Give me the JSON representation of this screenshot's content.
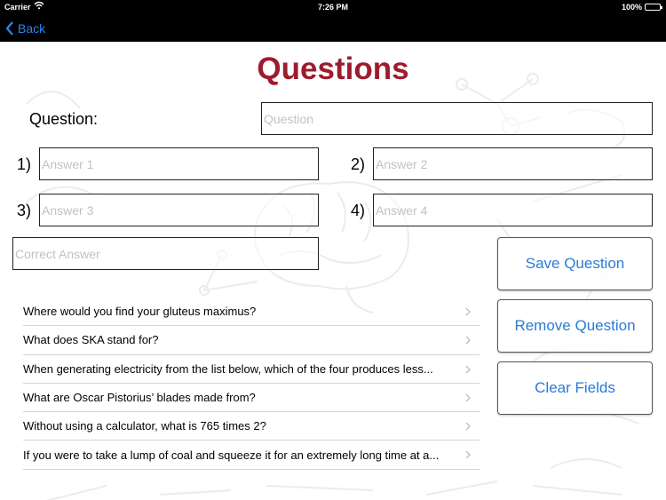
{
  "status_bar": {
    "carrier": "Carrier",
    "time": "7:26 PM",
    "battery": "100%"
  },
  "nav": {
    "back_label": "Back"
  },
  "title": "Questions",
  "question": {
    "label": "Question:",
    "placeholder": "Question"
  },
  "answers": [
    {
      "number": "1)",
      "placeholder": "Answer 1"
    },
    {
      "number": "2)",
      "placeholder": "Answer 2"
    },
    {
      "number": "3)",
      "placeholder": "Answer 3"
    },
    {
      "number": "4)",
      "placeholder": "Answer 4"
    }
  ],
  "correct_answer": {
    "placeholder": "Correct Answer"
  },
  "buttons": {
    "save": "Save Question",
    "remove": "Remove Question",
    "clear": "Clear Fields"
  },
  "questions": [
    "Where would you find your gluteus maximus?",
    "What does SKA stand for?",
    "When generating electricity from the list below, which of the four produces less...",
    "What are Oscar Pistorius’ blades made from?",
    "Without using a calculator, what is 765 times 2?",
    "If you were to take a lump of coal and squeeze it for an extremely long time at a..."
  ],
  "colors": {
    "title": "#9e1b2e",
    "accent": "#2a7bd6"
  },
  "icons": {
    "back": "chevron-left-icon",
    "row": "chevron-right-icon",
    "wifi": "wifi-icon",
    "battery": "battery-icon"
  }
}
